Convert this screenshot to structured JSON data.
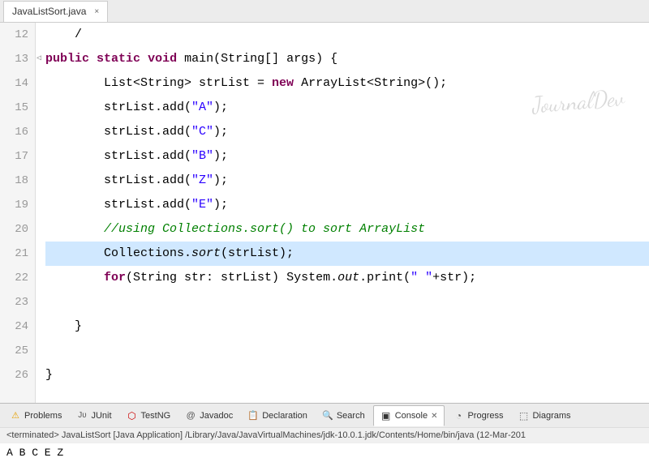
{
  "tab": {
    "label": "JavaListSort.java",
    "close": "×"
  },
  "lines": [
    {
      "num": "12",
      "content": "    /",
      "parts": []
    },
    {
      "num": "13",
      "arrow": true,
      "parts": [
        {
          "t": "kw",
          "v": "public"
        },
        {
          "t": "plain",
          "v": " "
        },
        {
          "t": "kw",
          "v": "static"
        },
        {
          "t": "plain",
          "v": " "
        },
        {
          "t": "kw",
          "v": "void"
        },
        {
          "t": "plain",
          "v": " main(String[] args) {"
        }
      ]
    },
    {
      "num": "14",
      "parts": [
        {
          "t": "plain",
          "v": "        List<String> strList = "
        },
        {
          "t": "kw",
          "v": "new"
        },
        {
          "t": "plain",
          "v": " ArrayList<String>();"
        }
      ]
    },
    {
      "num": "15",
      "parts": [
        {
          "t": "plain",
          "v": "        strList.add("
        },
        {
          "t": "string",
          "v": "\"A\""
        },
        {
          "t": "plain",
          "v": ");"
        }
      ]
    },
    {
      "num": "16",
      "parts": [
        {
          "t": "plain",
          "v": "        strList.add("
        },
        {
          "t": "string",
          "v": "\"C\""
        },
        {
          "t": "plain",
          "v": ");"
        }
      ]
    },
    {
      "num": "17",
      "parts": [
        {
          "t": "plain",
          "v": "        strList.add("
        },
        {
          "t": "string",
          "v": "\"B\""
        },
        {
          "t": "plain",
          "v": ");"
        }
      ]
    },
    {
      "num": "18",
      "parts": [
        {
          "t": "plain",
          "v": "        strList.add("
        },
        {
          "t": "string",
          "v": "\"Z\""
        },
        {
          "t": "plain",
          "v": ");"
        }
      ]
    },
    {
      "num": "19",
      "parts": [
        {
          "t": "plain",
          "v": "        strList.add("
        },
        {
          "t": "string",
          "v": "\"E\""
        },
        {
          "t": "plain",
          "v": ");"
        }
      ]
    },
    {
      "num": "20",
      "parts": [
        {
          "t": "comment",
          "v": "        //using Collections.sort() to sort ArrayList"
        }
      ]
    },
    {
      "num": "21",
      "highlight": true,
      "parts": [
        {
          "t": "plain",
          "v": "        Collections."
        },
        {
          "t": "italic",
          "v": "sort"
        },
        {
          "t": "plain",
          "v": "(strList);"
        }
      ]
    },
    {
      "num": "22",
      "parts": [
        {
          "t": "kw",
          "v": "        for"
        },
        {
          "t": "plain",
          "v": "(String str: strList) System."
        },
        {
          "t": "italic",
          "v": "out"
        },
        {
          "t": "plain",
          "v": ".print("
        },
        {
          "t": "string",
          "v": "\" \""
        },
        {
          "t": "plain",
          "v": "+str);"
        }
      ]
    },
    {
      "num": "23",
      "parts": []
    },
    {
      "num": "24",
      "parts": [
        {
          "t": "plain",
          "v": "    }"
        }
      ]
    },
    {
      "num": "25",
      "parts": []
    },
    {
      "num": "26",
      "parts": [
        {
          "t": "plain",
          "v": "}"
        }
      ]
    }
  ],
  "watermark": "JournalDev",
  "bottomTabs": [
    {
      "id": "problems",
      "label": "Problems",
      "icon": "problems"
    },
    {
      "id": "junit",
      "label": "JUnit",
      "icon": "junit"
    },
    {
      "id": "testng",
      "label": "TestNG",
      "icon": "testng"
    },
    {
      "id": "javadoc",
      "label": "Javadoc",
      "icon": "javadoc"
    },
    {
      "id": "declaration",
      "label": "Declaration",
      "icon": "declaration"
    },
    {
      "id": "search",
      "label": "Search",
      "icon": "search"
    },
    {
      "id": "console",
      "label": "Console",
      "icon": "console",
      "active": true
    },
    {
      "id": "progress",
      "label": "Progress",
      "icon": "progress"
    },
    {
      "id": "diagrams",
      "label": "Diagrams",
      "icon": "diagrams"
    }
  ],
  "terminatedText": "<terminated> JavaListSort [Java Application] /Library/Java/JavaVirtualMachines/jdk-10.0.1.jdk/Contents/Home/bin/java (12-Mar-201",
  "outputText": "A  B  C  E  Z"
}
